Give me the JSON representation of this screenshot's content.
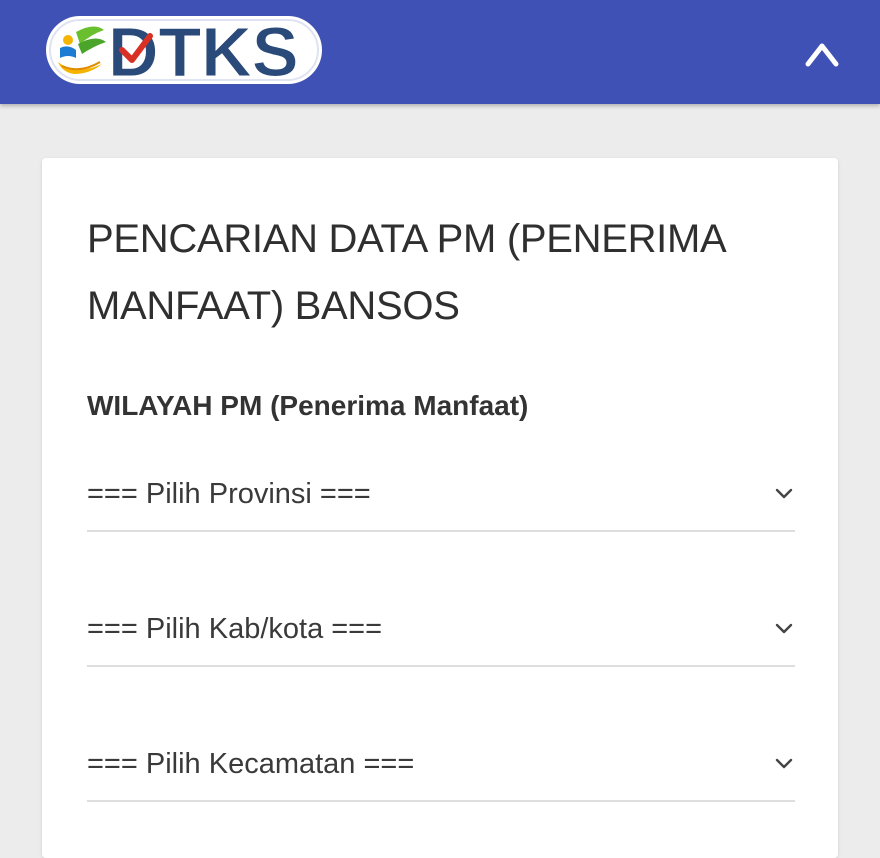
{
  "header": {
    "brand": "DTKS",
    "bg_color": "#3f51b5",
    "menu_icon": "caret-up-icon"
  },
  "main": {
    "title": "PENCARIAN DATA PM (PENERIMA MANFAAT) BANSOS",
    "section_label": "WILAYAH PM (Penerima Manfaat)",
    "selects": [
      {
        "value": "=== Pilih Provinsi ===",
        "icon": "chevron-down-icon"
      },
      {
        "value": "=== Pilih Kab/kota ===",
        "icon": "chevron-down-icon"
      },
      {
        "value": "=== Pilih Kecamatan ===",
        "icon": "chevron-down-icon"
      }
    ]
  }
}
